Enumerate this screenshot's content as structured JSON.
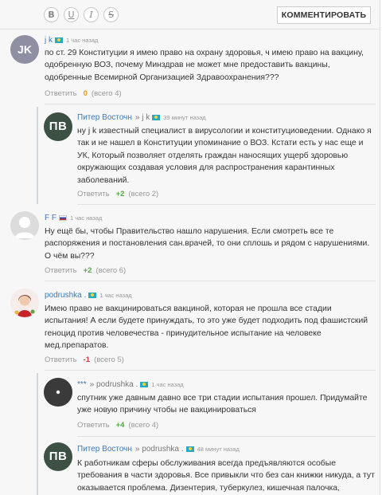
{
  "toolbar": {
    "bold": "B",
    "underline": "U",
    "italic": "I",
    "strike": "S",
    "submit": "КОММЕНТИРОВАТЬ"
  },
  "comments": [
    {
      "avatar_initials": "JK",
      "author": "j k",
      "flag": "kz",
      "time": "1 час назад",
      "text": "по ст. 29 Конституции я имею право на охрану здоровья, ч имею право на вакцину, одобренную ВОЗ, почему Минздрав не может мне предоставить вакцины, одобренные Всемирной Организацией Здравоохранения???",
      "reply": "Ответить",
      "score": "0",
      "count": "(всего 4)"
    },
    {
      "avatar_initials": "ПВ",
      "author": "Питер Восточн",
      "reply_to": "j k",
      "flag": "kz",
      "time": "39 минут назад",
      "text": "ну j k известный специалист в вирусологии и конституциоведении. Однако я так и не нашел в Конституции упоминание о ВОЗ. Кстати есть у нас еще и УК, Который позволяет отделять граждан наносящих ущерб здоровью окружающих создавая условия для распространения карантинных заболеваний.",
      "reply": "Ответить",
      "score": "+2",
      "count": "(всего 2)"
    },
    {
      "author": "F F",
      "flag": "ru",
      "time": "1 час назад",
      "text": "Ну ещё бы, чтобы Правительство нашло нарушения. Если смотреть все те распоряжения и постановления сан.врачей, то они сплошь и рядом с нарушениями. О чём вы???",
      "reply": "Ответить",
      "score": "+2",
      "count": "(всего 6)"
    },
    {
      "author": "podrushka .",
      "flag": "kz",
      "time": "1 час назад",
      "text": "Имею право не вакцинироваться вакциной, которая не прошла все стадии испытания! А если будете принуждать, то это уже будет подходить под фашистский геноцид против человечества - принудительное испытание на человеке мед.препаратов.",
      "reply": "Ответить",
      "score": "-1",
      "count": "(всего 5)"
    },
    {
      "author": "***",
      "reply_to": "podrushka .",
      "flag": "kz",
      "time": "1 час назад",
      "text": "спутник уже давным давно все три стадии испытания прошел. Придумайте уже новую причину чтобы не вакцинироваться",
      "reply": "Ответить",
      "score": "+4",
      "count": "(всего 4)"
    },
    {
      "avatar_initials": "ПВ",
      "author": "Питер Восточн",
      "reply_to": "podrushka .",
      "flag": "kz",
      "time": "48 минут назад",
      "text": "К работникам сферы обслуживания всегда предъявляются особые требования в части здоровья. Все привыкли что без сан книжки никуда, а тут оказывается проблема. Дизентерия, туберкулез, кишечная палочка,"
    }
  ],
  "colors": {
    "author_link": "#3b79b8",
    "score_zero": "#e39b1b",
    "score_positive": "#53a84a",
    "score_negative": "#d23c3c",
    "avatar_pv": "#3c5044",
    "avatar_jk": "#8e8fa3"
  }
}
